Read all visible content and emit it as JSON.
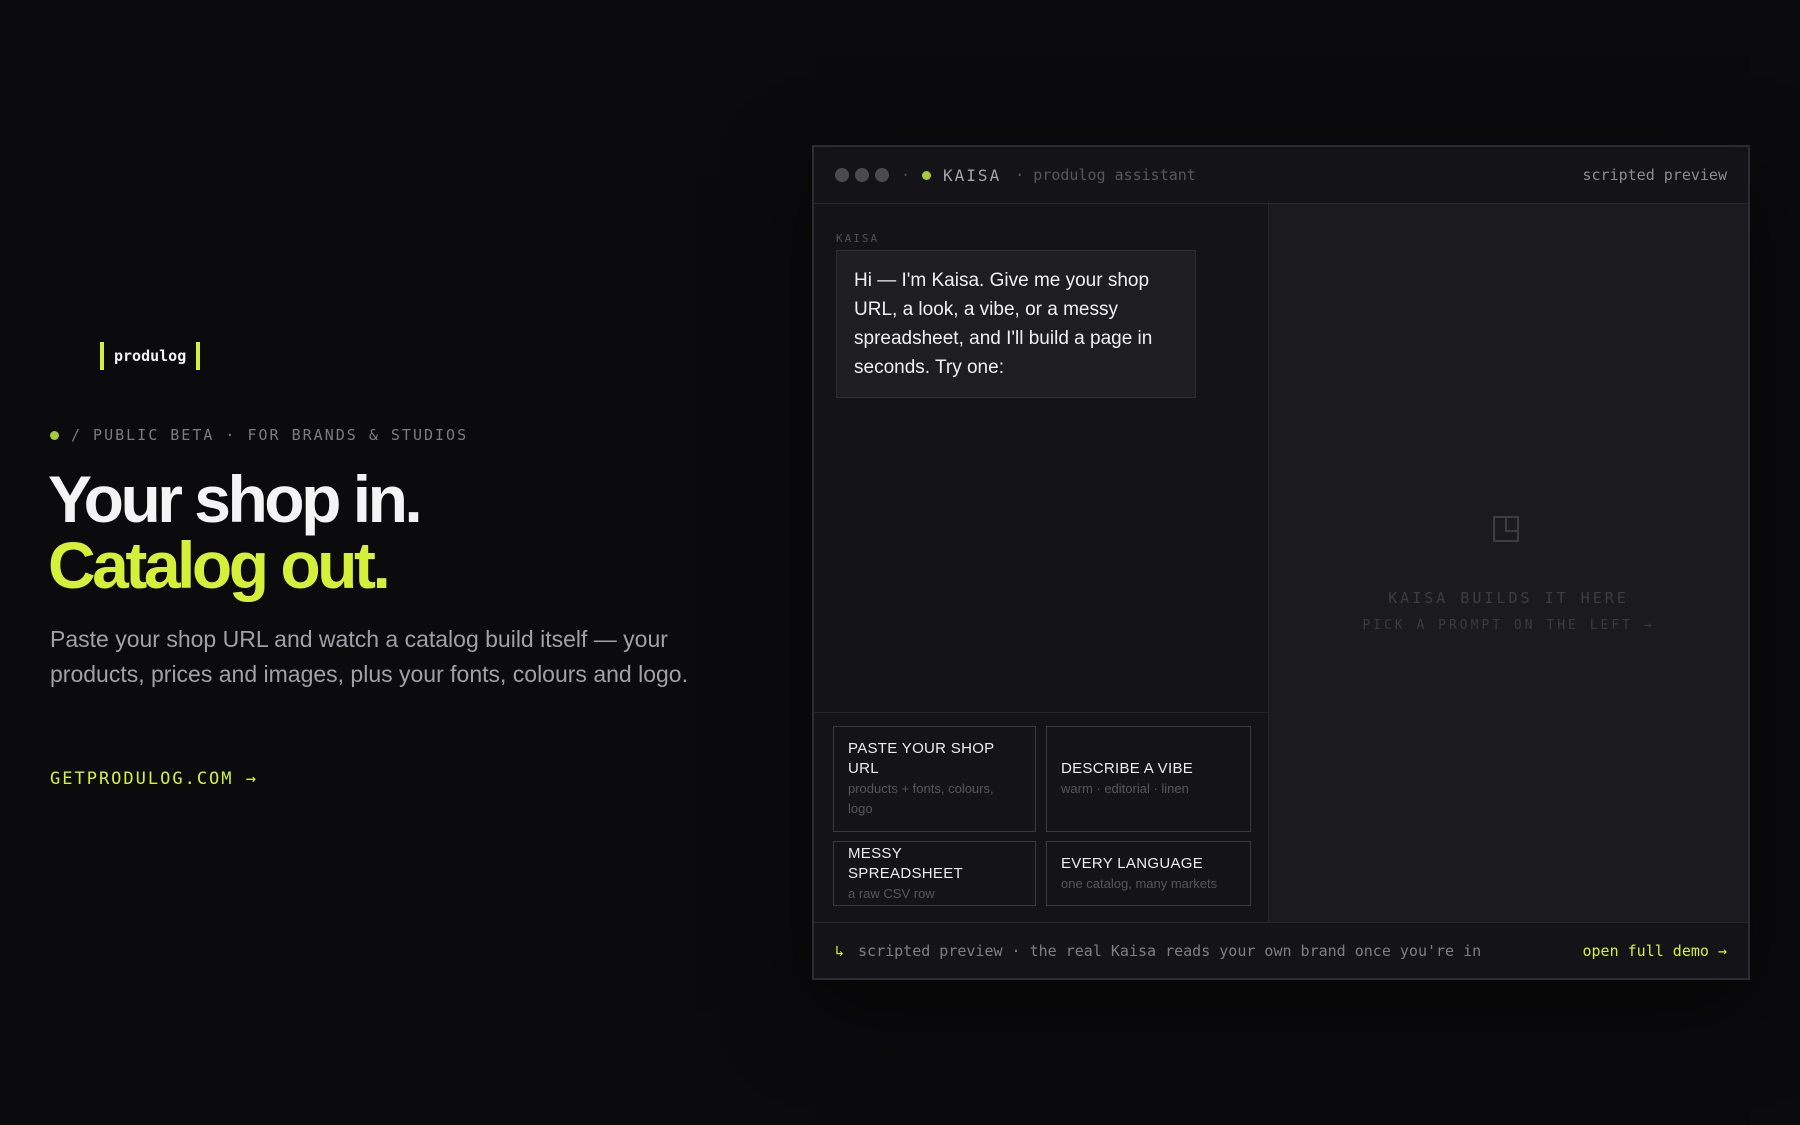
{
  "brand": {
    "logo_text": "produlog",
    "accent": "#d4f03a"
  },
  "hero": {
    "eyebrow": "/ PUBLIC BETA · FOR BRANDS & STUDIOS",
    "headline_line1": "Your shop in.",
    "headline_line2": "Catalog out.",
    "lede": "Paste your shop URL and watch a catalog build itself — your products, prices and images, plus your fonts, colours and logo.",
    "cta": "GETPRODULOG.COM →"
  },
  "preview": {
    "titlebar": {
      "separator": "·",
      "agent_name": "KAISA",
      "agent_subtitle": "· produlog assistant",
      "right_label": "scripted preview"
    },
    "chat": {
      "sender": "KAISA",
      "message": "Hi — I'm Kaisa. Give me your shop URL, a look, a vibe, or a messy spreadsheet, and I'll build a page in seconds. Try one:"
    },
    "prompts": [
      {
        "title": "PASTE YOUR SHOP URL",
        "subtitle": "products + fonts, colours, logo"
      },
      {
        "title": "DESCRIBE A VIBE",
        "subtitle": "warm · editorial · linen"
      },
      {
        "title": "MESSY SPREADSHEET",
        "subtitle": "a raw CSV row"
      },
      {
        "title": "EVERY LANGUAGE",
        "subtitle": "one catalog, many markets"
      }
    ],
    "canvas": {
      "icon": "layout-icon",
      "placeholder_title": "KAISA BUILDS IT HERE",
      "placeholder_hint": "PICK A PROMPT ON THE LEFT →"
    },
    "footer": {
      "arrow": "↳",
      "note": "scripted preview · the real Kaisa reads your own brand once you're in",
      "demo_link": "open full demo →"
    }
  }
}
